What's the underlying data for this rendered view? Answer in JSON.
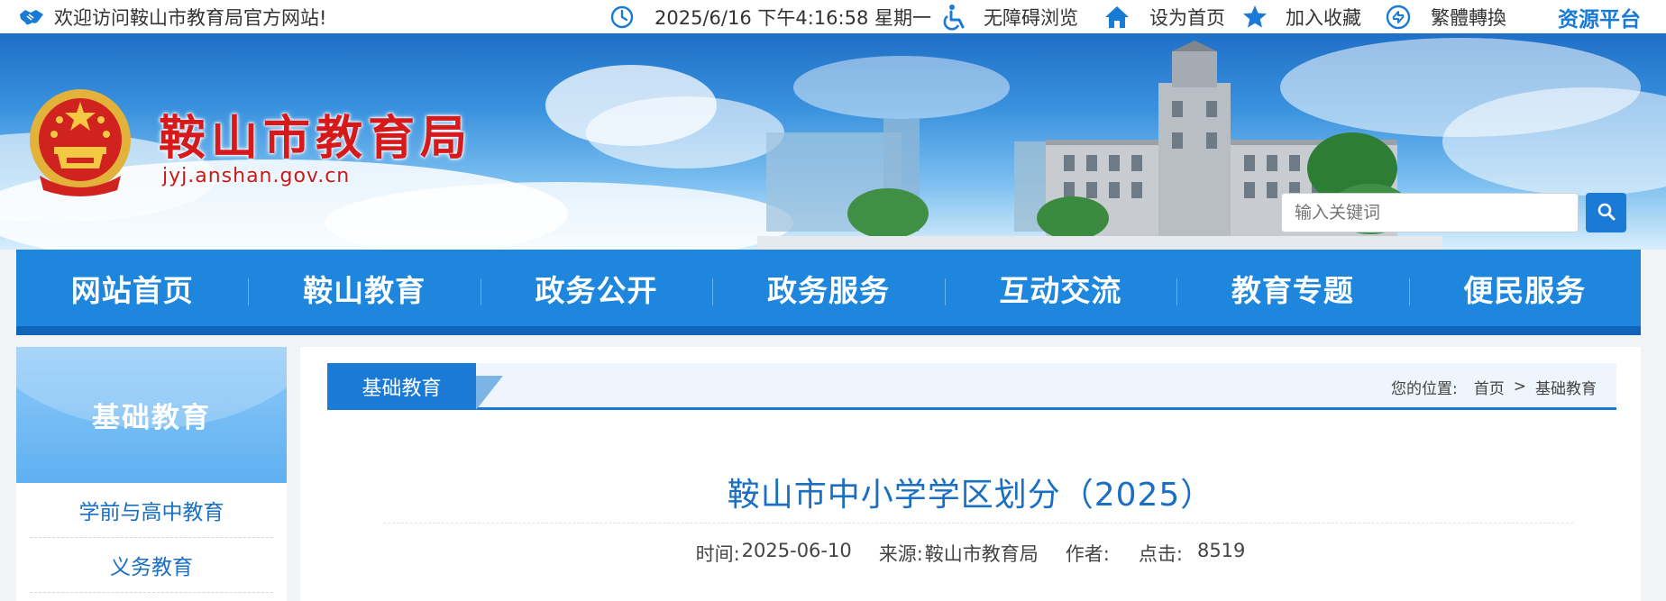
{
  "topbar": {
    "welcome": "欢迎访问鞍山市教育局官方网站!",
    "datetime": "2025/6/16 下午4:16:58 星期一",
    "accessible": "无障碍浏览",
    "set_home": "设为首页",
    "favorite": "加入收藏",
    "traditional": "繁體轉換",
    "resource": "资源平台",
    "icons": [
      "handshake-icon",
      "clock-icon",
      "wheelchair-icon",
      "home-icon",
      "star-icon",
      "convert-icon"
    ],
    "accent_color": "#1a7bd6"
  },
  "banner": {
    "title": "鞍山市教育局",
    "domain": "jyj.anshan.gov.cn",
    "title_color": "#d6191b"
  },
  "search": {
    "placeholder": "输入关键词"
  },
  "nav": {
    "items": [
      "网站首页",
      "鞍山教育",
      "政务公开",
      "政务服务",
      "互动交流",
      "教育专题",
      "便民服务"
    ],
    "bg_color": "#1e87dd"
  },
  "sidebar": {
    "heading": "基础教育",
    "items": [
      "学前与高中教育",
      "义务教育"
    ]
  },
  "content": {
    "tab": "基础教育",
    "location_label": "您的位置:",
    "crumb_home": "首页",
    "crumb_sep": ">",
    "crumb_current": "基础教育",
    "title": "鞍山市中小学学区划分（2025）",
    "meta": {
      "time_label": "时间:",
      "time": "2025-06-10",
      "source_label": "来源:",
      "source": "鞍山市教育局",
      "author_label": "作者:",
      "author": "",
      "clicks_label": "点击:",
      "clicks": "8519"
    }
  }
}
